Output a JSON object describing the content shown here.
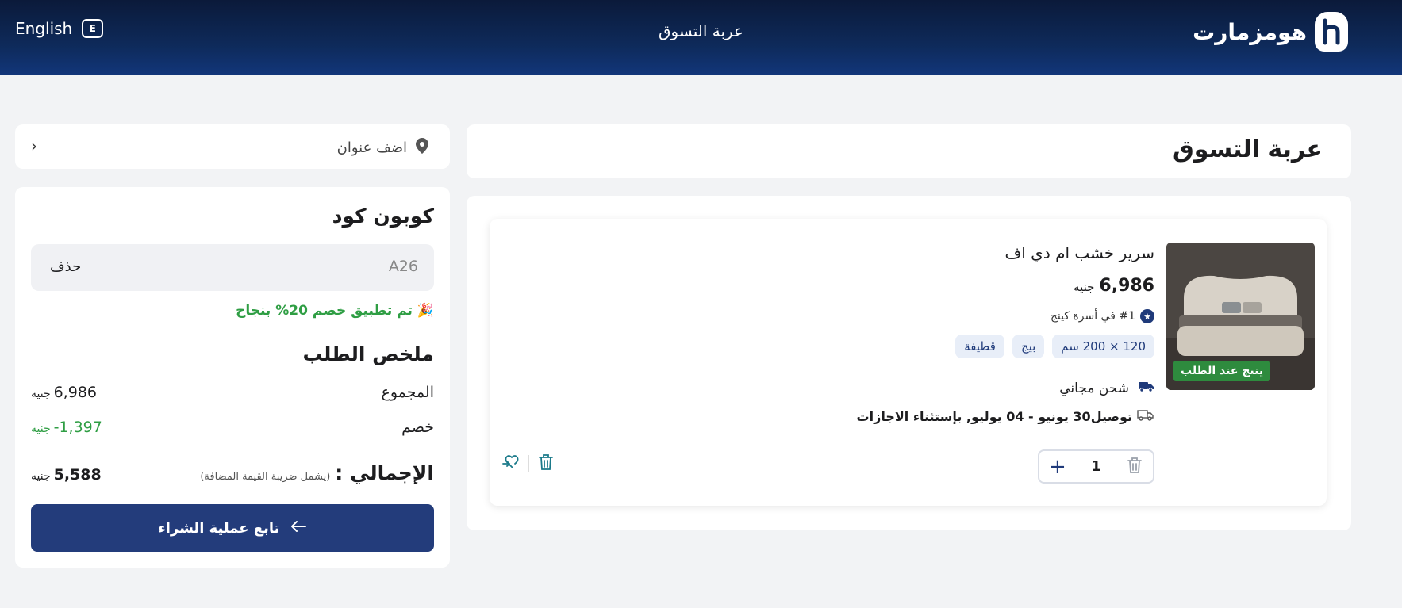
{
  "header": {
    "lang_label": "English",
    "lang_badge": "E",
    "title": "عربة التسوق",
    "brand": "هومزمارت"
  },
  "page": {
    "title": "عربة التسوق"
  },
  "item": {
    "badge": "ينتج عند الطلب",
    "name": "سرير خشب ام دي اف",
    "price": "6,986",
    "currency": "جنيه",
    "rank": "#1 في أسرة كينج",
    "tags": [
      "120 × 200 سم",
      "بيج",
      "قطيفة"
    ],
    "shipping": "شحن مجاني",
    "delivery": "توصيل30 يونيو - 04 يوليو, بإستثناء الاجازات",
    "quantity": "1"
  },
  "address": {
    "label": "اضف عنوان"
  },
  "coupon": {
    "heading": "كوبون كود",
    "code": "A26",
    "remove_label": "حذف",
    "success": "🎉 تم تطبيق خصم 20% بنجاح"
  },
  "summary": {
    "heading": "ملخص الطلب",
    "subtotal_label": "المجموع",
    "subtotal_value": "6,986",
    "discount_label": "خصم",
    "discount_value": "-1,397",
    "currency": "جنيه",
    "total_label": "الإجمالي :",
    "vat_note": "(يشمل ضريبة القيمة المضافة)",
    "total_value": "5,588",
    "checkout_label": "تابع عملية الشراء"
  },
  "colors": {
    "header": "#0e2a5a",
    "primary": "#233c7b",
    "success": "#2f9e44",
    "badge_green": "#2e8b3e"
  }
}
